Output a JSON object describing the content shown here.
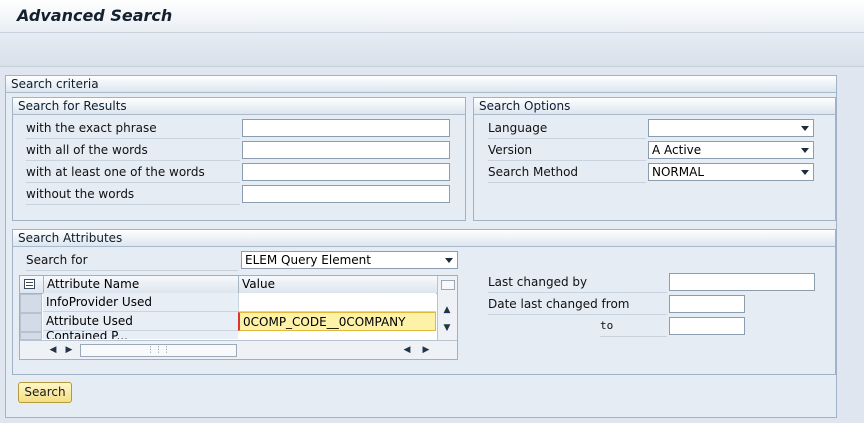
{
  "window": {
    "title": "Advanced Search"
  },
  "criteria": {
    "title": "Search criteria",
    "results": {
      "title": "Search for Results",
      "fields": [
        {
          "label": "with the exact phrase",
          "value": ""
        },
        {
          "label": "with all of the words",
          "value": ""
        },
        {
          "label": "with at least one of the words",
          "value": ""
        },
        {
          "label": "without the words",
          "value": ""
        }
      ]
    },
    "options": {
      "title": "Search Options",
      "language_label": "Language",
      "language_value": "",
      "version_label": "Version",
      "version_value": "A Active",
      "method_label": "Search Method",
      "method_value": "NORMAL"
    },
    "attributes": {
      "title": "Search Attributes",
      "search_for_label": "Search for",
      "search_for_value": "ELEM Query Element",
      "table": {
        "columns": [
          "Attribute Name",
          "Value"
        ],
        "rows": [
          {
            "name": "InfoProvider Used",
            "value": ""
          },
          {
            "name": "Attribute Used",
            "value": "0COMP_CODE__0COMPANY"
          },
          {
            "name": "Contained P...",
            "value": ""
          }
        ]
      },
      "last_changed_by_label": "Last changed by",
      "last_changed_by_value": "",
      "date_from_label": "Date last changed from",
      "date_from_value": "",
      "date_to_label": "to",
      "date_to_value": ""
    }
  },
  "search_button": "Search"
}
